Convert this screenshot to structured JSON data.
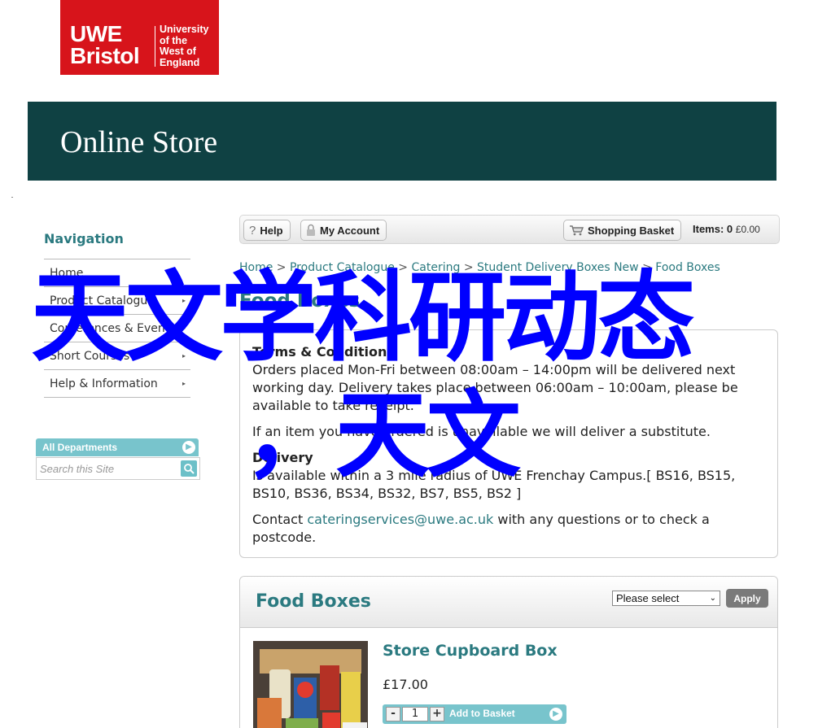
{
  "logo": {
    "line1": "UWE",
    "line2": "Bristol",
    "uni1": "University",
    "uni2": "of the",
    "uni3": "West of",
    "uni4": "England"
  },
  "banner": {
    "title": "Online Store"
  },
  "nav": {
    "heading": "Navigation",
    "items": [
      {
        "label": "Home",
        "has_arrow": false
      },
      {
        "label": "Product Catalogue",
        "has_arrow": true
      },
      {
        "label": "Conferences & Events",
        "has_arrow": true
      },
      {
        "label": "Short Courses",
        "has_arrow": true
      },
      {
        "label": "Help & Information",
        "has_arrow": true
      }
    ]
  },
  "search": {
    "dept_label": "All Departments",
    "placeholder": "Search this Site"
  },
  "toolbar": {
    "help": "Help",
    "account": "My Account",
    "basket": "Shopping Basket",
    "items_label": "Items:",
    "items_count": "0",
    "items_amount": "£0.00"
  },
  "breadcrumb": {
    "items": [
      "Home",
      "Product Catalogue",
      "Catering",
      "Student Delivery Boxes New"
    ],
    "current": "Food Boxes",
    "separator": ">"
  },
  "page_title": "Food Boxes",
  "terms": {
    "heading": "Terms & Conditions",
    "para1": "Orders placed Mon-Fri between 08:00am – 14:00pm will be delivered next working day. Delivery takes place between 06:00am – 10:00am, please be available to take receipt.",
    "para2": "If an item you have ordered is unavailable we will deliver a substitute.",
    "delivery_heading": "Delivery",
    "delivery_text": "Is available within a 3 mile radius of UWE Frenchay Campus.[ BS16, BS15, BS10, BS36, BS34, BS32, BS7, BS5, BS2 ]",
    "contact_prefix": "Contact ",
    "contact_email": "cateringservices@uwe.ac.uk",
    "contact_suffix": " with any questions or to check a postcode."
  },
  "products": {
    "title": "Food Boxes",
    "sort_placeholder": "Please select",
    "apply": "Apply",
    "items": [
      {
        "name": "Store Cupboard Box",
        "price": "£17.00",
        "quantity": "1",
        "add_label": "Add to Basket"
      }
    ]
  },
  "overlay": {
    "line1": "天文学科研动态",
    "line2": "，天文"
  },
  "colors": {
    "brand_red": "#d7141b",
    "banner_teal": "#0f4143",
    "accent_teal": "#2b7a80",
    "light_teal": "#78c4cc",
    "overlay_blue": "#0000ff"
  }
}
